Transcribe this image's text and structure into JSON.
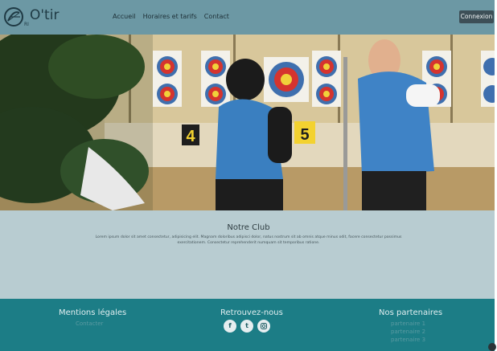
{
  "header": {
    "brand": "O'tir",
    "brand_sub": "RI",
    "nav": [
      "Accueil",
      "Horaires et tarifs",
      "Contact"
    ],
    "login_label": "Connexion"
  },
  "hero": {
    "target_numbers": [
      "4",
      "5"
    ]
  },
  "club": {
    "title": "Notre Club",
    "text": "Lorem ipsum dolor sit amet consectetur, adipisicing elit. Magnam doloribus adipisci dolor, natus nostrum sit ab omnis atque minus odit, facere consectetur possimus exercitationem. Consectetur reprehenderit numquam sit temporibus ratione."
  },
  "footer": {
    "legal": {
      "title": "Mentions légales",
      "link": "Contacter"
    },
    "social": {
      "title": "Retrouvez-nous",
      "icons": [
        "facebook-icon",
        "twitter-icon",
        "instagram-icon"
      ]
    },
    "partners": {
      "title": "Nos partenaires",
      "items": [
        "partenaire 1",
        "partenaire 2",
        "partenaire 3"
      ]
    }
  },
  "colors": {
    "header": "#6c98a4",
    "club": "#b8ccd1",
    "footer": "#1c7d86",
    "button": "#3d4f57"
  }
}
